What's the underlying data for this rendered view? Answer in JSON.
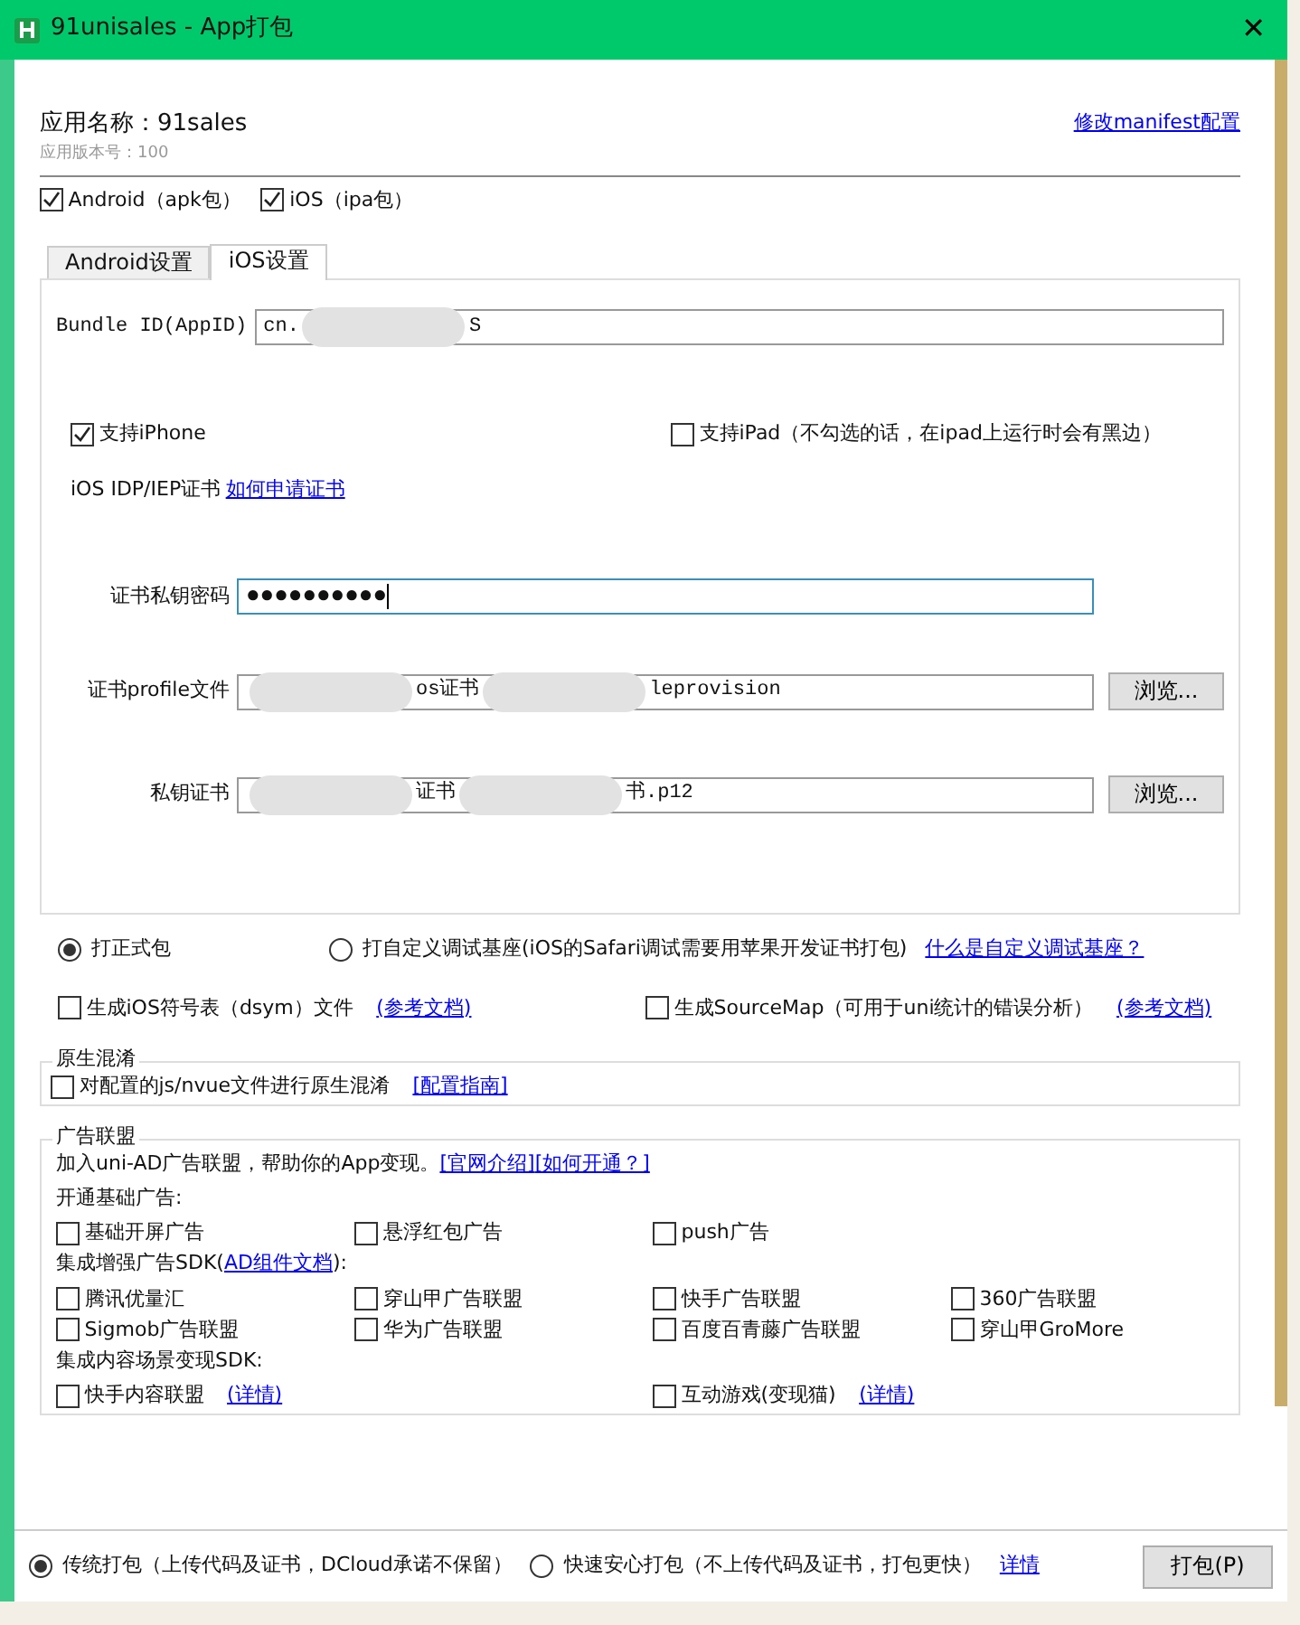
{
  "window": {
    "title": "91unisales - App打包",
    "close": "✕"
  },
  "app": {
    "name_label": "应用名称：91sales",
    "version": "应用版本号：100",
    "manifest_link": "修改manifest配置"
  },
  "platforms": [
    {
      "label": "Android（apk包）",
      "checked": true
    },
    {
      "label": "iOS（ipa包）",
      "checked": true
    }
  ],
  "tabs": [
    {
      "label": "Android设置",
      "selected": false
    },
    {
      "label": "iOS设置",
      "selected": true
    }
  ],
  "ios": {
    "bundle": {
      "label": "Bundle ID(AppID)",
      "parts": [
        {
          "text": "cn."
        },
        {
          "kind": "blur"
        },
        {
          "text": "S"
        }
      ]
    },
    "devices": [
      {
        "label": "支持iPhone",
        "checked": true
      },
      {
        "label": "支持iPad（不勾选的话，在ipad上运行时会有黑边）",
        "checked": false
      }
    ],
    "cert_label": "iOS IDP/IEP证书",
    "cert_link": "如何申请证书",
    "password": {
      "label": "证书私钥密码",
      "value": "●●●●●●●●●●",
      "focused": true
    },
    "files": [
      {
        "label": "证书profile文件",
        "parts": [
          {
            "kind": "blur"
          },
          {
            "text": "os证书"
          },
          {
            "kind": "blur"
          },
          {
            "text": "leprovision"
          }
        ],
        "button": "浏览..."
      },
      {
        "label": "私钥证书",
        "parts": [
          {
            "kind": "blur"
          },
          {
            "text": "证书"
          },
          {
            "kind": "blur"
          },
          {
            "text": "书.p12"
          }
        ],
        "button": "浏览..."
      }
    ]
  },
  "build_type": [
    {
      "label": "打正式包",
      "selected": true
    },
    {
      "label": "打自定义调试基座(iOS的Safari调试需要用苹果开发证书打包)",
      "selected": false,
      "link": "什么是自定义调试基座？"
    }
  ],
  "extras": [
    {
      "label": "生成iOS符号表（dsym）文件",
      "checked": false,
      "link": "(参考文档)"
    },
    {
      "label": "生成SourceMap（可用于uni统计的错误分析）",
      "checked": false,
      "link": "(参考文档)"
    }
  ],
  "obfuscation": {
    "legend": "原生混淆",
    "label": "对配置的js/nvue文件进行原生混淆",
    "checked": false,
    "link": "[配置指南]"
  },
  "ads": {
    "legend": "广告联盟",
    "intro": "加入uni-AD广告联盟，帮助你的App变现。",
    "links": [
      "[官网介绍]",
      "[如何开通？]"
    ],
    "basic_heading": "开通基础广告:",
    "basic": [
      {
        "label": "基础开屏广告",
        "checked": false
      },
      {
        "label": "悬浮红包广告",
        "checked": false
      },
      {
        "label": "push广告",
        "checked": false
      }
    ],
    "sdk_heading": "集成增强广告SDK(",
    "sdk_link": "AD组件文档",
    "sdk_heading_end": "):",
    "sdk": [
      {
        "label": "腾讯优量汇",
        "checked": false
      },
      {
        "label": "穿山甲广告联盟",
        "checked": false
      },
      {
        "label": "快手广告联盟",
        "checked": false
      },
      {
        "label": "360广告联盟",
        "checked": false
      },
      {
        "label": "Sigmob广告联盟",
        "checked": false
      },
      {
        "label": "华为广告联盟",
        "checked": false
      },
      {
        "label": "百度百青藤广告联盟",
        "checked": false
      },
      {
        "label": "穿山甲GroMore",
        "checked": false
      }
    ],
    "content_heading": "集成内容场景变现SDK:",
    "content": [
      {
        "label": "快手内容联盟",
        "checked": false,
        "link": "(详情)"
      },
      {
        "label": "互动游戏(变现猫)",
        "checked": false,
        "link": "(详情)"
      }
    ]
  },
  "footer": {
    "modes": [
      {
        "label": "传统打包（上传代码及证书，DCloud承诺不保留）",
        "selected": true
      },
      {
        "label": "快速安心打包（不上传代码及证书，打包更快）",
        "selected": false
      }
    ],
    "link": "详情",
    "button": "打包(P)"
  }
}
